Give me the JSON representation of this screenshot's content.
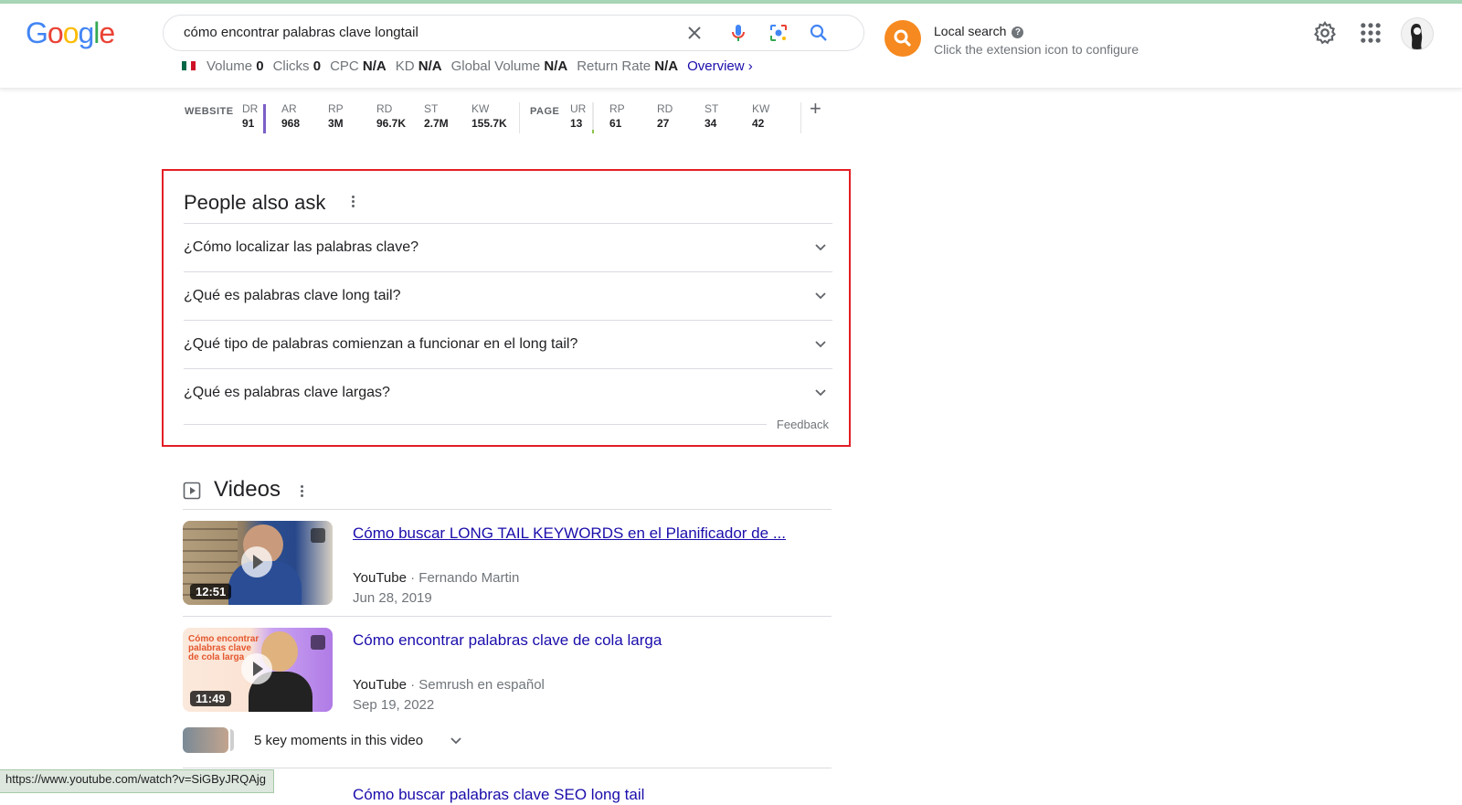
{
  "header": {
    "logo_letters": [
      "G",
      "o",
      "o",
      "g",
      "l",
      "e"
    ],
    "logo_colors": [
      "#4285f4",
      "#ea4335",
      "#fbbc05",
      "#4285f4",
      "#34a853",
      "#ea4335"
    ],
    "search_query": "cómo encontrar palabras clave longtail",
    "icons": [
      "close-icon",
      "mic-icon",
      "lens-icon",
      "search-icon",
      "settings-icon",
      "apps-icon",
      "avatar"
    ]
  },
  "keyword_bar": {
    "volume_label": "Volume",
    "volume_value": "0",
    "clicks_label": "Clicks",
    "clicks_value": "0",
    "cpc_label": "CPC",
    "cpc_value": "N/A",
    "kd_label": "KD",
    "kd_value": "N/A",
    "global_label": "Global Volume",
    "global_value": "N/A",
    "return_label": "Return Rate",
    "return_value": "N/A",
    "overview_label": "Overview ›"
  },
  "extension": {
    "title": "Local search",
    "subtitle": "Click the extension icon to configure",
    "accent": "#f6891f"
  },
  "metrics": {
    "website_caption": "WEBSITE",
    "page_caption": "PAGE",
    "website": [
      {
        "label": "DR",
        "value": "91"
      },
      {
        "label": "AR",
        "value": "968"
      },
      {
        "label": "RP",
        "value": "3M"
      },
      {
        "label": "RD",
        "value": "96.7K"
      },
      {
        "label": "ST",
        "value": "2.7M"
      },
      {
        "label": "KW",
        "value": "155.7K"
      }
    ],
    "page": [
      {
        "label": "UR",
        "value": "13"
      },
      {
        "label": "RP",
        "value": "61"
      },
      {
        "label": "RD",
        "value": "27"
      },
      {
        "label": "ST",
        "value": "34"
      },
      {
        "label": "KW",
        "value": "42"
      }
    ],
    "add_label": "+"
  },
  "people_also_ask": {
    "title": "People also ask",
    "questions": [
      "¿Cómo localizar las palabras clave?",
      "¿Qué es palabras clave long tail?",
      "¿Qué tipo de palabras comienzan a funcionar en el long tail?",
      "¿Qué es palabras clave largas?"
    ],
    "feedback": "Feedback",
    "highlight_color": "#e41e26"
  },
  "videos": {
    "title": "Videos",
    "items": [
      {
        "title": "Cómo buscar LONG TAIL KEYWORDS en el Planificador de ...",
        "source": "YouTube",
        "author": "· Fernando Martin",
        "date": "Jun 28, 2019",
        "duration": "12:51"
      },
      {
        "title": "Cómo encontrar palabras clave de cola larga",
        "source": "YouTube",
        "author": "· Semrush en español",
        "date": "Sep 19, 2022",
        "duration": "11:49",
        "thumb_text": "Cómo encontrar palabras clave de cola larga"
      }
    ],
    "key_moments": "5 key moments in this video",
    "next_partial": "Cómo buscar palabras clave SEO long tail"
  },
  "status_url": "https://www.youtube.com/watch?v=SiGByJRQAjg"
}
